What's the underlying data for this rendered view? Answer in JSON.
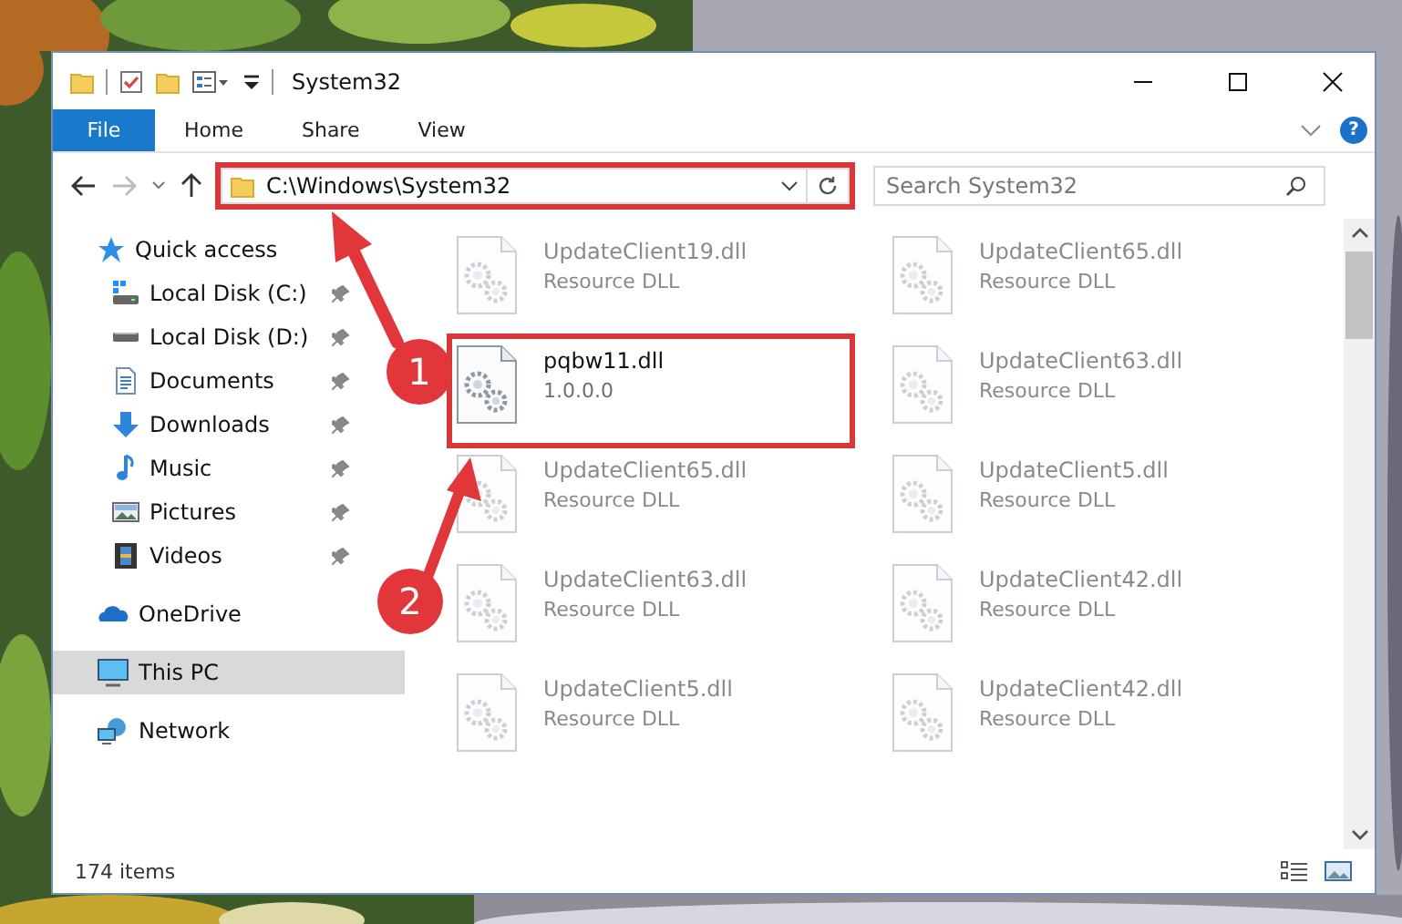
{
  "window": {
    "title": "System32"
  },
  "ribbon_tabs": [
    {
      "label": "File",
      "kind": "file"
    },
    {
      "label": "Home",
      "kind": "tab"
    },
    {
      "label": "Share",
      "kind": "tab"
    },
    {
      "label": "View",
      "kind": "tab"
    }
  ],
  "help": "?",
  "address": {
    "path": "C:\\Windows\\System32",
    "highlighted": true
  },
  "search": {
    "placeholder": "Search System32"
  },
  "sidebar": {
    "items": [
      {
        "label": "Quick access",
        "kind": "star",
        "selected": false,
        "children": [
          {
            "label": "Local Disk (C:)",
            "kind": "drive-win",
            "pinned": true,
            "selected": false
          },
          {
            "label": "Local Disk (D:)",
            "kind": "drive",
            "pinned": true,
            "selected": false
          },
          {
            "label": "Documents",
            "kind": "documents",
            "pinned": true,
            "selected": false
          },
          {
            "label": "Downloads",
            "kind": "downloads",
            "pinned": true,
            "selected": false
          },
          {
            "label": "Music",
            "kind": "music",
            "pinned": true,
            "selected": false
          },
          {
            "label": "Pictures",
            "kind": "pictures",
            "pinned": true,
            "selected": false
          },
          {
            "label": "Videos",
            "kind": "videos",
            "pinned": true,
            "selected": false
          }
        ]
      },
      {
        "label": "OneDrive",
        "kind": "cloud",
        "selected": false
      },
      {
        "label": "This PC",
        "kind": "pc",
        "selected": true
      },
      {
        "label": "Network",
        "kind": "network",
        "selected": false
      }
    ]
  },
  "files": [
    {
      "name": "UpdateClient19.dll",
      "detail": "Resource DLL",
      "blurred": true,
      "highlighted": false
    },
    {
      "name": "UpdateClient65.dll",
      "detail": "Resource DLL",
      "blurred": true,
      "highlighted": false
    },
    {
      "name": "pqbw11.dll",
      "detail": "1.0.0.0",
      "blurred": false,
      "highlighted": true
    },
    {
      "name": "UpdateClient63.dll",
      "detail": "Resource DLL",
      "blurred": true,
      "highlighted": false
    },
    {
      "name": "UpdateClient65.dll",
      "detail": "Resource DLL",
      "blurred": true,
      "highlighted": false
    },
    {
      "name": "UpdateClient5.dll",
      "detail": "Resource DLL",
      "blurred": true,
      "highlighted": false
    },
    {
      "name": "UpdateClient63.dll",
      "detail": "Resource DLL",
      "blurred": true,
      "highlighted": false
    },
    {
      "name": "UpdateClient42.dll",
      "detail": "Resource DLL",
      "blurred": true,
      "highlighted": false
    },
    {
      "name": "UpdateClient5.dll",
      "detail": "Resource DLL",
      "blurred": true,
      "highlighted": false
    },
    {
      "name": "UpdateClient42.dll",
      "detail": "Resource DLL",
      "blurred": true,
      "highlighted": false
    }
  ],
  "status_bar": {
    "count": "174 items"
  },
  "annotations": [
    {
      "label": "1"
    },
    {
      "label": "2"
    }
  ]
}
